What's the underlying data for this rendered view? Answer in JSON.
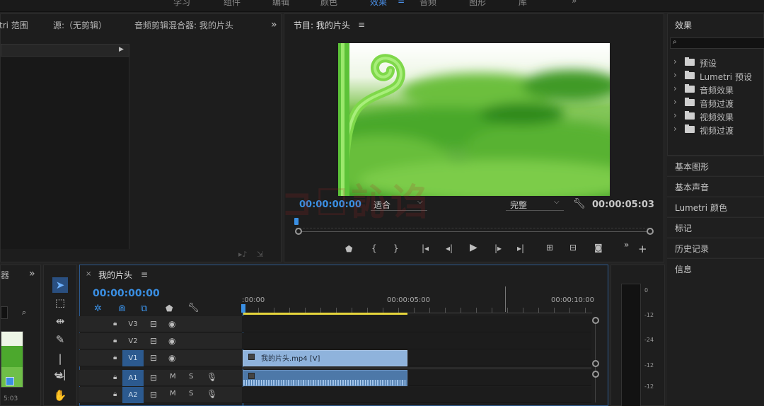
{
  "top_tabs": [
    "学习",
    "组件",
    "编辑",
    "颜色",
    "效果",
    "音频",
    "图形",
    "库"
  ],
  "top_tab_active": "效果",
  "source_panel": {
    "tabs": [
      "tri 范围",
      "源:（无剪辑）",
      "音频剪辑混合器: 我的片头"
    ]
  },
  "program_monitor": {
    "title": "节目: 我的片头",
    "timecode_left": "00:00:00:00",
    "fit_label": "适合",
    "quality_label": "完整",
    "timecode_right": "00:00:05:03"
  },
  "effects_panel": {
    "title": "效果",
    "search_placeholder": "",
    "items": [
      "预设",
      "Lumetri 预设",
      "音频效果",
      "音频过渡",
      "视频效果",
      "视频过渡"
    ],
    "sections": [
      "基本图形",
      "基本声音",
      "Lumetri 颜色",
      "标记",
      "历史记录",
      "信息"
    ]
  },
  "project_panel": {
    "tab": "器",
    "thumb_duration": "5:03"
  },
  "timeline": {
    "title": "我的片头",
    "timecode": "00:00:00:00",
    "ruler": [
      ":00:00",
      "00:00:05:00",
      "00:00:10:00"
    ],
    "tracks": [
      {
        "id": "V3",
        "selected": false,
        "m": "",
        "s": ""
      },
      {
        "id": "V2",
        "selected": false,
        "m": "",
        "s": ""
      },
      {
        "id": "V1",
        "selected": true,
        "m": "",
        "s": ""
      },
      {
        "id": "A1",
        "selected": true,
        "m": "M",
        "s": "S"
      },
      {
        "id": "A2",
        "selected": true,
        "m": "M",
        "s": "S"
      }
    ],
    "clip_label": "我的片头.mp4 [V]"
  },
  "audio_meter": {
    "ticks": [
      "0",
      "-12",
      "-24",
      "-12",
      "-12"
    ]
  },
  "colors": {
    "accent_blue": "#3a8fe3",
    "clip_video": "#8fb3dc",
    "clip_audio": "#4d78a8",
    "playhead_yellow": "#e6d53c"
  }
}
